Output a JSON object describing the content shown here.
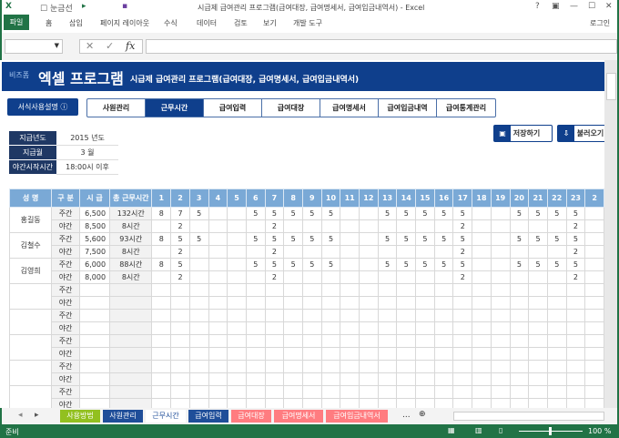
{
  "window": {
    "title": "시급제 급여관리 프로그램(급여대장, 급여명세서, 급여입금내역서) - Excel",
    "gridlines_label": "눈금선",
    "login": "로그인",
    "controls": [
      "?",
      "▣",
      "—",
      "☐",
      "✕"
    ]
  },
  "ribbon": {
    "file": "파일",
    "tabs": [
      "홈",
      "삽입",
      "페이지 레이아웃",
      "수식",
      "데이터",
      "검토",
      "보기",
      "개발 도구"
    ]
  },
  "formula": {
    "fx": "fx",
    "cancel": "✕",
    "enter": "✓"
  },
  "banner": {
    "brand": "비즈폼",
    "title": "엑셀 프로그램",
    "subtitle": "시급제 급여관리 프로그램(급여대장, 급여명세서, 급여입금내역서)"
  },
  "guide_button": "서식사용설명 ⓘ",
  "nav": [
    "사원관리",
    "근무시간",
    "급여입력",
    "급여대장",
    "급여명세서",
    "급여입금내역",
    "급여통계관리"
  ],
  "info": [
    {
      "k": "지급년도",
      "v": "2015 년도"
    },
    {
      "k": "지급월",
      "v": "3 월"
    },
    {
      "k": "야간시작시간",
      "v": "18:00시 이후"
    }
  ],
  "buttons": {
    "save": "저장하기",
    "load": "불러오기"
  },
  "table": {
    "headers": [
      "성 명",
      "구 분",
      "시 급",
      "총 근무시간"
    ],
    "days": [
      "1",
      "2",
      "3",
      "4",
      "5",
      "6",
      "7",
      "8",
      "9",
      "10",
      "11",
      "12",
      "13",
      "14",
      "15",
      "16",
      "17",
      "18",
      "19",
      "20",
      "21",
      "22",
      "23",
      "2"
    ],
    "employees": [
      {
        "name": "홍길동",
        "rows": [
          {
            "type": "주간",
            "wage": "6,500",
            "total": "132시간",
            "days": {
              "1": "8",
              "2": "7",
              "3": "5",
              "6": "5",
              "7": "5",
              "8": "5",
              "9": "5",
              "10": "5",
              "13": "5",
              "14": "5",
              "15": "5",
              "16": "5",
              "17": "5",
              "20": "5",
              "21": "5",
              "22": "5",
              "23": "5"
            }
          },
          {
            "type": "야간",
            "wage": "8,500",
            "total": "8시간",
            "days": {
              "2": "2",
              "7": "2",
              "17": "2",
              "23": "2"
            }
          }
        ]
      },
      {
        "name": "김철수",
        "rows": [
          {
            "type": "주간",
            "wage": "5,600",
            "total": "93시간",
            "days": {
              "1": "8",
              "2": "5",
              "3": "5",
              "6": "5",
              "7": "5",
              "8": "5",
              "9": "5",
              "10": "5",
              "13": "5",
              "14": "5",
              "15": "5",
              "16": "5",
              "17": "5",
              "20": "5",
              "21": "5",
              "22": "5",
              "23": "5"
            }
          },
          {
            "type": "야간",
            "wage": "7,500",
            "total": "8시간",
            "days": {
              "2": "2",
              "7": "2",
              "17": "2",
              "23": "2"
            }
          }
        ]
      },
      {
        "name": "김영희",
        "rows": [
          {
            "type": "주간",
            "wage": "6,000",
            "total": "88시간",
            "days": {
              "1": "8",
              "2": "5",
              "6": "5",
              "7": "5",
              "8": "5",
              "9": "5",
              "10": "5",
              "13": "5",
              "14": "5",
              "15": "5",
              "16": "5",
              "17": "5",
              "20": "5",
              "21": "5",
              "22": "5",
              "23": "5"
            }
          },
          {
            "type": "야간",
            "wage": "8,000",
            "total": "8시간",
            "days": {
              "2": "2",
              "7": "2",
              "17": "2",
              "23": "2"
            }
          }
        ]
      },
      {
        "name": "",
        "rows": [
          {
            "type": "주간"
          },
          {
            "type": "야간"
          }
        ]
      },
      {
        "name": "",
        "rows": [
          {
            "type": "주간"
          },
          {
            "type": "야간"
          }
        ]
      },
      {
        "name": "",
        "rows": [
          {
            "type": "주간"
          },
          {
            "type": "야간"
          }
        ]
      },
      {
        "name": "",
        "rows": [
          {
            "type": "주간"
          },
          {
            "type": "야간"
          }
        ]
      },
      {
        "name": "",
        "rows": [
          {
            "type": "주간"
          },
          {
            "type": "야간"
          }
        ]
      }
    ]
  },
  "sheet_tabs": [
    {
      "label": "사용방법",
      "color": "#92c01f"
    },
    {
      "label": "사원관리",
      "color": "#1f4e99"
    },
    {
      "label": "근무시간",
      "color": "#dfe8f3"
    },
    {
      "label": "급여입력",
      "color": "#1f4e99"
    },
    {
      "label": "급여대장",
      "color": "#ff7c80"
    },
    {
      "label": "급여명세서",
      "color": "#ff7c80"
    },
    {
      "label": "급여입금내역서",
      "color": "#ff7c80"
    }
  ],
  "sheet_more": "...",
  "status": {
    "ready": "준비",
    "zoom": "100 %"
  }
}
